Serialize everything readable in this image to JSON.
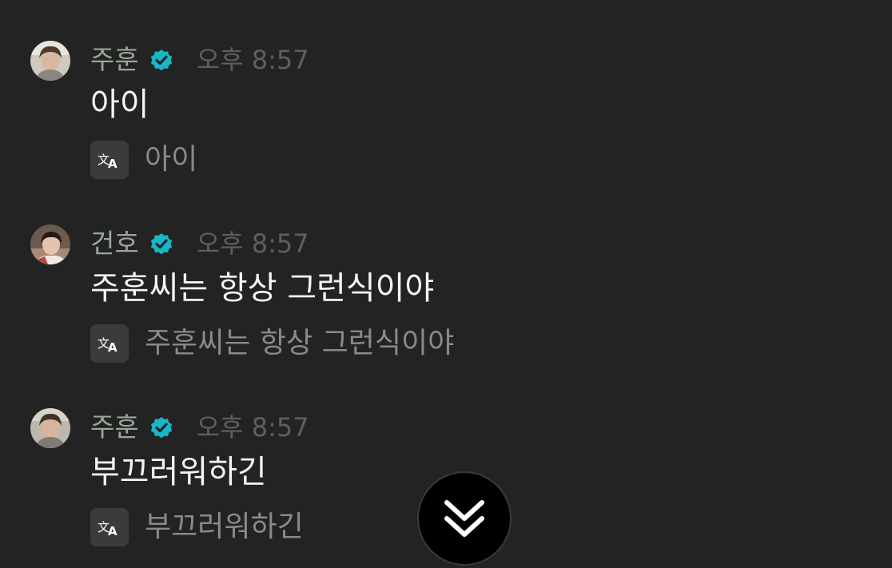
{
  "messages": [
    {
      "sender": "주훈",
      "time": "오후 8:57",
      "text": "아이",
      "translation": "아이"
    },
    {
      "sender": "건호",
      "time": "오후 8:57",
      "text": "주훈씨는 항상 그런식이야",
      "translation": "주훈씨는 항상 그런식이야"
    },
    {
      "sender": "주훈",
      "time": "오후 8:57",
      "text": "부끄러워하긴",
      "translation": "부끄러워하긴"
    }
  ],
  "icons": {
    "verified": "verified-badge-icon",
    "translate": "translate-icon",
    "scroll_down": "double-chevron-down-icon"
  },
  "colors": {
    "background": "#232323",
    "verified_badge": "#19b6c6",
    "sender_name": "#9aa79a",
    "timestamp": "#5f5f5f",
    "message_text": "#f4f4f4",
    "translated_text": "#8a8a8a"
  }
}
